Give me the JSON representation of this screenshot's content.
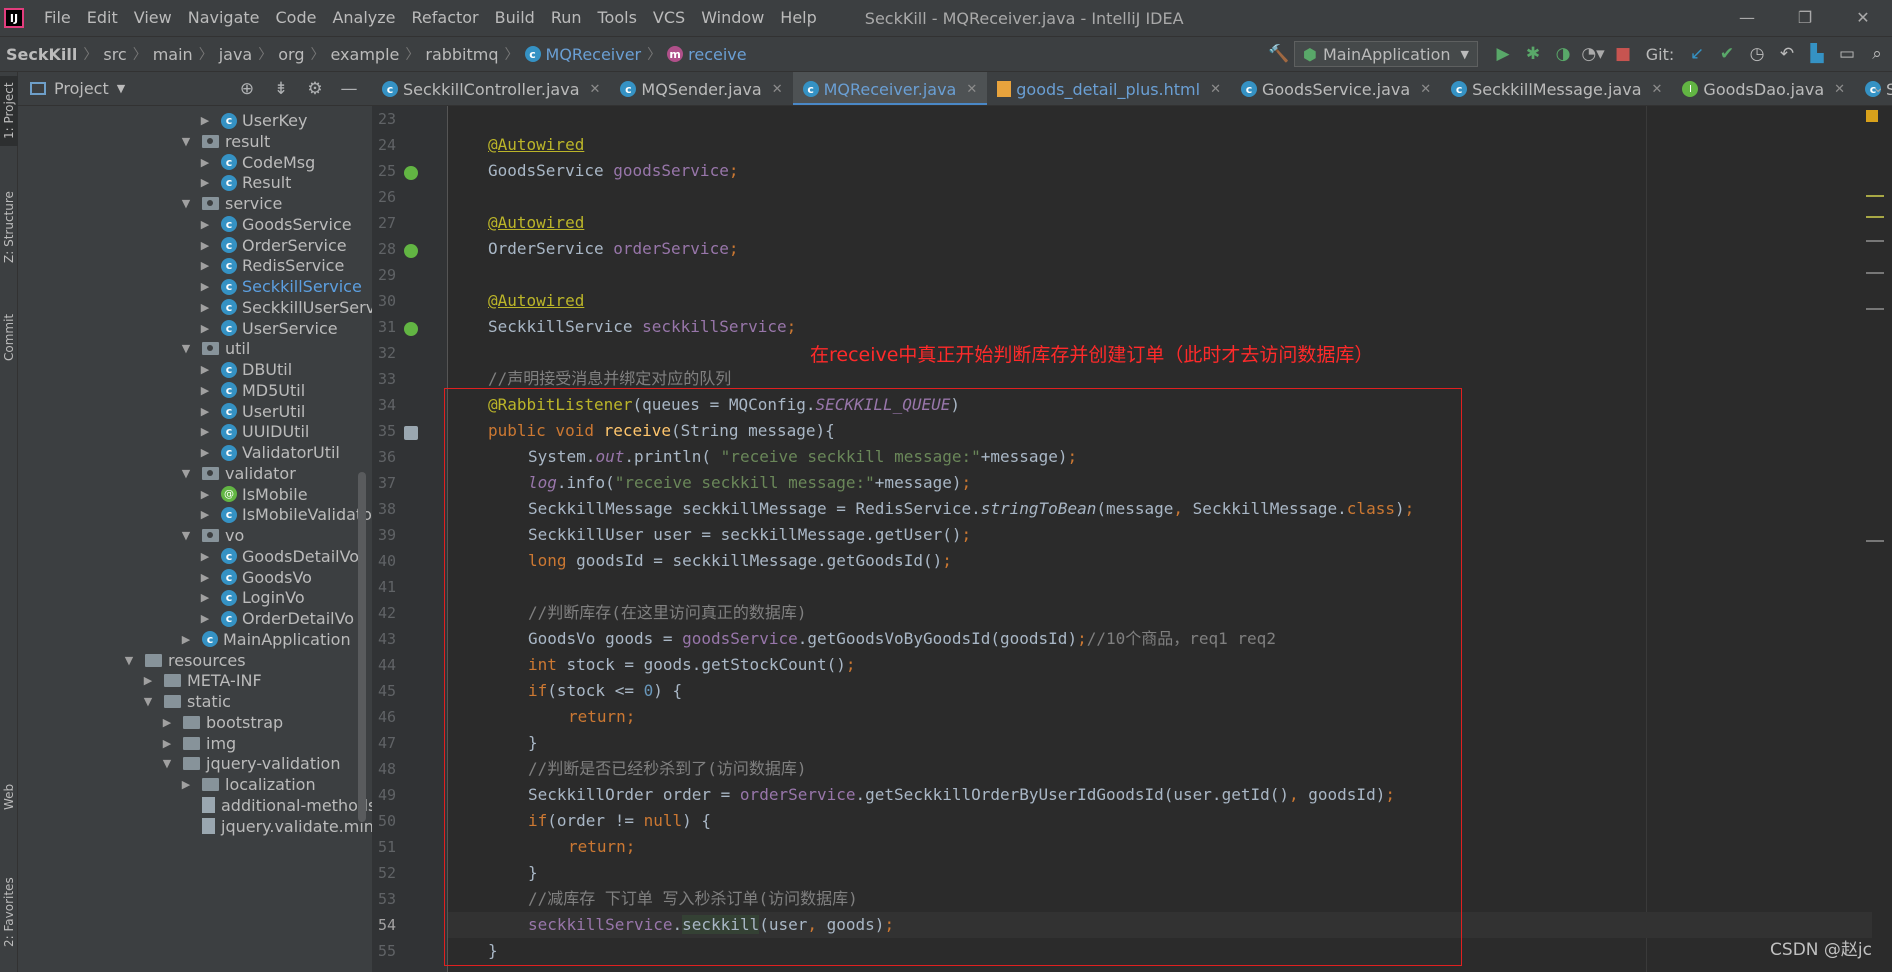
{
  "window": {
    "title": "SeckKill - MQReceiver.java - IntelliJ IDEA",
    "logo_text": "IJ",
    "menu": [
      "File",
      "Edit",
      "View",
      "Navigate",
      "Code",
      "Analyze",
      "Refactor",
      "Build",
      "Run",
      "Tools",
      "VCS",
      "Window",
      "Help"
    ]
  },
  "breadcrumb": [
    "SeckKill",
    "src",
    "main",
    "java",
    "org",
    "example",
    "rabbitmq",
    "MQReceiver",
    "receive"
  ],
  "toolbar": {
    "run_config": "MainApplication",
    "git_label": "Git:"
  },
  "left_strip": {
    "project": "1: Project",
    "structure": "Z: Structure",
    "commit": "Commit",
    "web": "Web",
    "favorites": "2: Favorites"
  },
  "project_panel": {
    "title": "Project",
    "tree": [
      {
        "label": "UserKey",
        "kind": "class",
        "depth": 3,
        "arrow": "▶"
      },
      {
        "label": "result",
        "kind": "package",
        "depth": 2,
        "arrow": "▼"
      },
      {
        "label": "CodeMsg",
        "kind": "class",
        "depth": 3,
        "arrow": "▶"
      },
      {
        "label": "Result",
        "kind": "class",
        "depth": 3,
        "arrow": "▶"
      },
      {
        "label": "service",
        "kind": "package",
        "depth": 2,
        "arrow": "▼"
      },
      {
        "label": "GoodsService",
        "kind": "class",
        "depth": 3,
        "arrow": "▶"
      },
      {
        "label": "OrderService",
        "kind": "class",
        "depth": 3,
        "arrow": "▶"
      },
      {
        "label": "RedisService",
        "kind": "class",
        "depth": 3,
        "arrow": "▶"
      },
      {
        "label": "SeckkillService",
        "kind": "class",
        "depth": 3,
        "arrow": "▶",
        "highlight": true
      },
      {
        "label": "SeckkillUserService",
        "kind": "class",
        "depth": 3,
        "arrow": "▶"
      },
      {
        "label": "UserService",
        "kind": "class",
        "depth": 3,
        "arrow": "▶"
      },
      {
        "label": "util",
        "kind": "package",
        "depth": 2,
        "arrow": "▼"
      },
      {
        "label": "DBUtil",
        "kind": "class",
        "depth": 3,
        "arrow": "▶"
      },
      {
        "label": "MD5Util",
        "kind": "class",
        "depth": 3,
        "arrow": "▶"
      },
      {
        "label": "UserUtil",
        "kind": "class",
        "depth": 3,
        "arrow": "▶"
      },
      {
        "label": "UUIDUtil",
        "kind": "class",
        "depth": 3,
        "arrow": "▶"
      },
      {
        "label": "ValidatorUtil",
        "kind": "class",
        "depth": 3,
        "arrow": "▶"
      },
      {
        "label": "validator",
        "kind": "package",
        "depth": 2,
        "arrow": "▼"
      },
      {
        "label": "IsMobile",
        "kind": "annotation",
        "depth": 3,
        "arrow": "▶"
      },
      {
        "label": "IsMobileValidator",
        "kind": "class",
        "depth": 3,
        "arrow": "▶"
      },
      {
        "label": "vo",
        "kind": "package",
        "depth": 2,
        "arrow": "▼"
      },
      {
        "label": "GoodsDetailVo",
        "kind": "class",
        "depth": 3,
        "arrow": "▶"
      },
      {
        "label": "GoodsVo",
        "kind": "class",
        "depth": 3,
        "arrow": "▶"
      },
      {
        "label": "LoginVo",
        "kind": "class",
        "depth": 3,
        "arrow": "▶"
      },
      {
        "label": "OrderDetailVo",
        "kind": "class",
        "depth": 3,
        "arrow": "▶"
      },
      {
        "label": "MainApplication",
        "kind": "mainclass",
        "depth": 2,
        "arrow": "▶"
      },
      {
        "label": "resources",
        "kind": "resfolder",
        "depth": -1,
        "arrow": "▼"
      },
      {
        "label": "META-INF",
        "kind": "folder",
        "depth": 0,
        "arrow": "▶"
      },
      {
        "label": "static",
        "kind": "folder",
        "depth": 0,
        "arrow": "▼"
      },
      {
        "label": "bootstrap",
        "kind": "folder",
        "depth": 1,
        "arrow": "▶"
      },
      {
        "label": "img",
        "kind": "folder",
        "depth": 1,
        "arrow": "▶"
      },
      {
        "label": "jquery-validation",
        "kind": "folder",
        "depth": 1,
        "arrow": "▼"
      },
      {
        "label": "localization",
        "kind": "folder",
        "depth": 2,
        "arrow": "▶"
      },
      {
        "label": "additional-methods.mi",
        "kind": "file",
        "depth": 2,
        "arrow": ""
      },
      {
        "label": "jquery.validate.min.js",
        "kind": "file",
        "depth": 2,
        "arrow": ""
      }
    ]
  },
  "tabs": [
    {
      "label": "SeckkillController.java",
      "icon": "c",
      "active": false
    },
    {
      "label": "MQSender.java",
      "icon": "c",
      "active": false
    },
    {
      "label": "MQReceiver.java",
      "icon": "c",
      "active": true
    },
    {
      "label": "goods_detail_plus.html",
      "icon": "html",
      "active": false
    },
    {
      "label": "GoodsService.java",
      "icon": "c",
      "active": false
    },
    {
      "label": "SeckkillMessage.java",
      "icon": "c",
      "active": false
    },
    {
      "label": "GoodsDao.java",
      "icon": "i",
      "active": false
    },
    {
      "label": "Seckkil",
      "icon": "c",
      "active": false
    }
  ],
  "line_numbers": [
    "23",
    "24",
    "25",
    "26",
    "27",
    "28",
    "29",
    "30",
    "31",
    "32",
    "33",
    "34",
    "35",
    "36",
    "37",
    "38",
    "39",
    "40",
    "41",
    "42",
    "43",
    "44",
    "45",
    "46",
    "47",
    "48",
    "49",
    "50",
    "51",
    "52",
    "53",
    "54",
    "55"
  ],
  "current_line": "54",
  "annotation_note": "在receive中真正开始判断库存并创建订单（此时才去访问数据库）",
  "watermark": "CSDN @赵jc"
}
